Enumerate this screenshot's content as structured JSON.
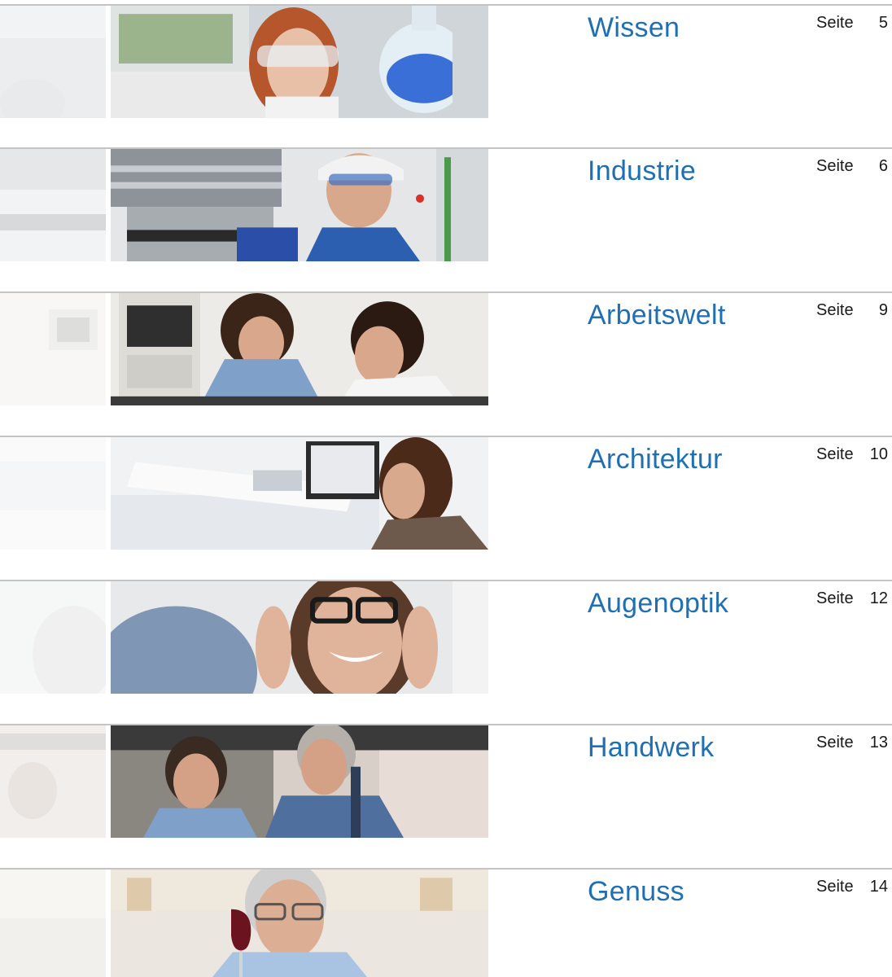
{
  "sections": [
    {
      "title": "Wissen",
      "seite_label": "Seite",
      "page": "5",
      "image": {
        "alt": "Frau mit Schutzbrille hält Laborkolben",
        "palette": {
          "bg": "#d9dde0",
          "accent": "#3b6fd8",
          "skin": "#e8c0a8",
          "hair": "#b5562c",
          "cloth": "#f2f2f2"
        }
      }
    },
    {
      "title": "Industrie",
      "seite_label": "Seite",
      "page": "6",
      "image": {
        "alt": "Arbeiter mit Helm an Maschine",
        "palette": {
          "bg": "#e4e6e8",
          "accent": "#2b4fa8",
          "skin": "#d7a88b",
          "hair": "#4a3a2e",
          "cloth": "#2d5fb0"
        }
      }
    },
    {
      "title": "Arbeitswelt",
      "seite_label": "Seite",
      "page": "9",
      "image": {
        "alt": "Zwei Personen im Büro",
        "palette": {
          "bg": "#ecebe8",
          "accent": "#2f2f2f",
          "skin": "#d8a78c",
          "hair": "#3b2418",
          "cloth": "#7fa0c8"
        }
      }
    },
    {
      "title": "Architektur",
      "seite_label": "Seite",
      "page": "10",
      "image": {
        "alt": "Frau mit Bauplänen und Laptop",
        "palette": {
          "bg": "#f1f2f4",
          "accent": "#c9ced4",
          "skin": "#d8a98c",
          "hair": "#4b2a1a",
          "cloth": "#6e5a4c"
        }
      }
    },
    {
      "title": "Augenoptik",
      "seite_label": "Seite",
      "page": "12",
      "image": {
        "alt": "Lächelnde Frau mit Brille",
        "palette": {
          "bg": "#e8e9ea",
          "accent": "#1a1a1a",
          "skin": "#e0b49a",
          "hair": "#5a3a28",
          "cloth": "#9eb8d8"
        }
      }
    },
    {
      "title": "Handwerk",
      "seite_label": "Seite",
      "page": "13",
      "image": {
        "alt": "Handwerker und Auszubildender",
        "palette": {
          "bg": "#d8cfc8",
          "accent": "#4a6690",
          "skin": "#d4a186",
          "hair": "#3a2b22",
          "cloth": "#4f6f9e"
        }
      }
    },
    {
      "title": "Genuss",
      "seite_label": "Seite",
      "page": "14",
      "image": {
        "alt": "Mann mit Brille und Rotweinglas",
        "palette": {
          "bg": "#ebe6df",
          "accent": "#6b1420",
          "skin": "#dcae93",
          "hair": "#cfcfcf",
          "cloth": "#a9c3e3"
        }
      }
    }
  ]
}
